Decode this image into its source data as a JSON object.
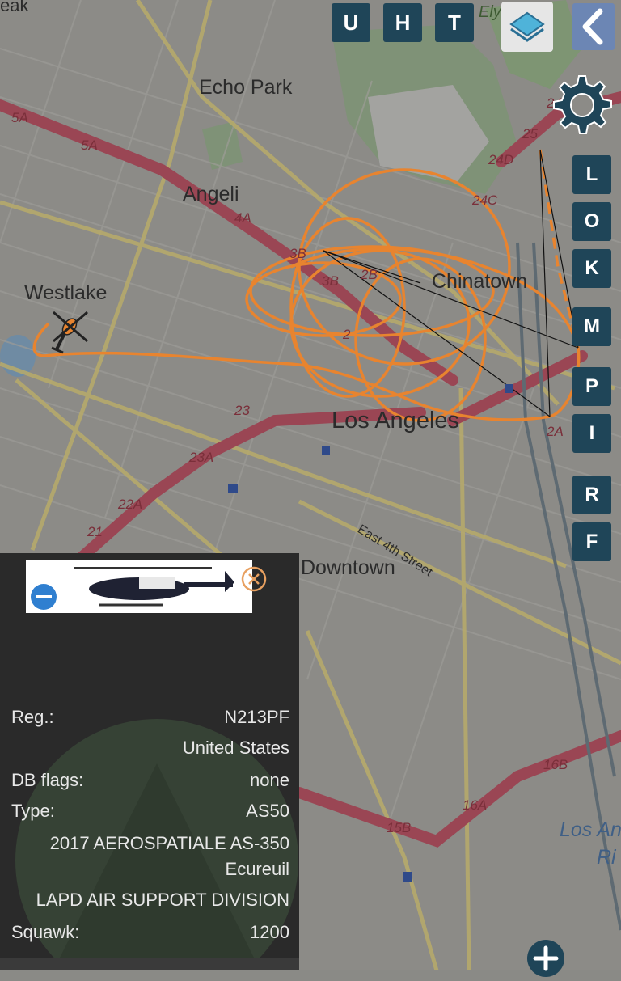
{
  "map": {
    "places": [
      "Echo Park",
      "Angeli",
      "Westlake",
      "Chinatown",
      "Los Angeles",
      "Downtown",
      "Los An",
      "Ri",
      "East 4th Street",
      "eak",
      "Ely"
    ],
    "route_shields": [
      "5A",
      "5A",
      "4A",
      "3B",
      "2B",
      "24",
      "24C",
      "24D",
      "25",
      "2A",
      "23",
      "23A",
      "22A",
      "21",
      "16B",
      "16A",
      "15B",
      "3B",
      "2"
    ],
    "track_color": "#e8842f"
  },
  "top_buttons": [
    "U",
    "H",
    "T"
  ],
  "side_buttons": [
    "L",
    "O",
    "K",
    "M",
    "P",
    "I",
    "R",
    "F"
  ],
  "icons": {
    "layers": "layers-icon",
    "back": "chevron-left-icon",
    "settings": "gear-icon",
    "close": "close-circle-icon",
    "zoom": "plus-icon",
    "aircraft": "helicopter-icon"
  },
  "details": {
    "reg_label": "Reg.:",
    "reg_value": "N213PF",
    "country": "United States",
    "dbflags_label": "DB flags:",
    "dbflags_value": "none",
    "type_label": "Type:",
    "type_value": "AS50",
    "model_line1": "2017 AEROSPATIALE AS-350",
    "model_line2": "Ecureuil",
    "operator": "LAPD AIR SUPPORT DIVISION",
    "squawk_label": "Squawk:",
    "squawk_value": "1200"
  },
  "colors": {
    "button_bg": "#1f4558",
    "panel_bg": "#2a2a2a",
    "track": "#e8842f",
    "freeway": "#9a4654"
  }
}
